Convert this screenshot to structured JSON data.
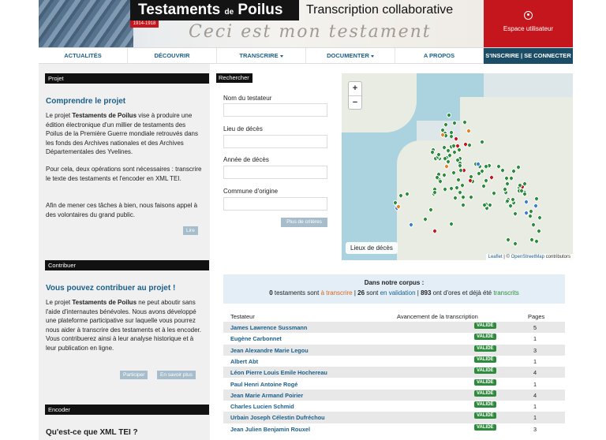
{
  "header": {
    "logo_part1": "Testaments",
    "logo_de": "de",
    "logo_part2": "Poilus",
    "date_badge": "1914-1918",
    "script_text": "Ceci est mon testament",
    "subtitle": "Transcription collaborative",
    "user_space_label": "Espace utilisateur",
    "user_icon": "user-circle-icon"
  },
  "nav": {
    "items": [
      "ACTUALITÉS",
      "DÉCOUVRIR",
      "TRANSCRIRE",
      "DOCUMENTER",
      "A PROPOS"
    ],
    "signup": "S'INSCRIRE | SE CONNECTER"
  },
  "projet": {
    "head": "Projet",
    "title": "Comprendre le projet",
    "p1_pre": "Le projet ",
    "p1_bold": "Testaments de Poilus",
    "p1_post": " vise à produire une édition électronique d'un millier de testaments des Poilus de la Première Guerre mondiale retrouvés dans les fonds des Archives nationales et des Archives Départementales des Yvelines.",
    "p2": "Pour cela, deux opérations sont nécessaires : transcrire le texte des testaments et l'encoder en XML TEI.",
    "p3": "Afin de mener ces tâches à bien, nous faisons appel à des volontaires du grand public.",
    "read_button": "Lire"
  },
  "contribuer": {
    "head": "Contribuer",
    "title": "Vous pouvez contribuer au projet !",
    "p1_pre": "Le projet ",
    "p1_bold": "Testaments de Poilus",
    "p1_post": " ne peut aboutir sans l'aide d'internautes bénévoles. Nous avons développé une plateforme participative sur laquelle vous pourrez nous aider à transcrire des testaments et à les encoder. Vous contribuerez ainsi à leur analyse historique et à leur publication en ligne.",
    "participate_button": "Participer",
    "more_button": "En savoir plus"
  },
  "encoder": {
    "head": "Encoder",
    "title": "Qu'est-ce que XML TEI ?"
  },
  "search": {
    "head": "Rechercher",
    "field1_label": "Nom du testateur",
    "field2_label": "Lieu de décès",
    "field3_label": "Année de décès",
    "field4_label": "Commune d'origine",
    "criteria_button": "Plus de critères"
  },
  "map": {
    "zoom_in": "+",
    "zoom_out": "−",
    "legend_button": "Lieux de décès",
    "attribution_leaflet": "Leaflet",
    "attribution_sep": " | © ",
    "attribution_osm": "OpenStreetMap",
    "attribution_rest": " contributors",
    "colors": {
      "water": "#aad3df",
      "land": "#e9ece3",
      "pin_default": "#2e8b3e",
      "pin_red": "#c6161d",
      "pin_blue": "#3b7bd0",
      "pin_orange": "#e6821e"
    }
  },
  "stats": {
    "title": "Dans notre corpus :",
    "n_to_transcribe": "0",
    "text1": " testaments sont ",
    "to_transcribe": "à transcrire",
    "text2": " | ",
    "n_validation": "26",
    "text3": " sont ",
    "in_validation": "en validation",
    "text4": " | ",
    "n_transcribed": "893",
    "text5": " ont d'ores et déjà été ",
    "transcribed": "transcrits"
  },
  "table": {
    "col_testateur": "Testateur",
    "col_avancement": "Avancement de la transcription",
    "col_pages": "Pages",
    "badge_label": "VALIDÉ",
    "rows": [
      {
        "name": "James Lawrence Sussmann",
        "pages": "5"
      },
      {
        "name": "Eugène Carbonnet",
        "pages": "1"
      },
      {
        "name": "Jean Alexandre Marie Legou",
        "pages": "3"
      },
      {
        "name": "Albert Abt",
        "pages": "1"
      },
      {
        "name": "Léon Pierre Louis Emile Hochereau",
        "pages": "4"
      },
      {
        "name": "Paul Henri Antoine Rogé",
        "pages": "1"
      },
      {
        "name": "Jean Marie Armand Poirier",
        "pages": "4"
      },
      {
        "name": "Charles Lucien Schmid",
        "pages": "1"
      },
      {
        "name": "Urbain Joseph Célestin Dufréchou",
        "pages": "1"
      },
      {
        "name": "Jean Julien Benjamin Rouxel",
        "pages": "3"
      }
    ]
  }
}
